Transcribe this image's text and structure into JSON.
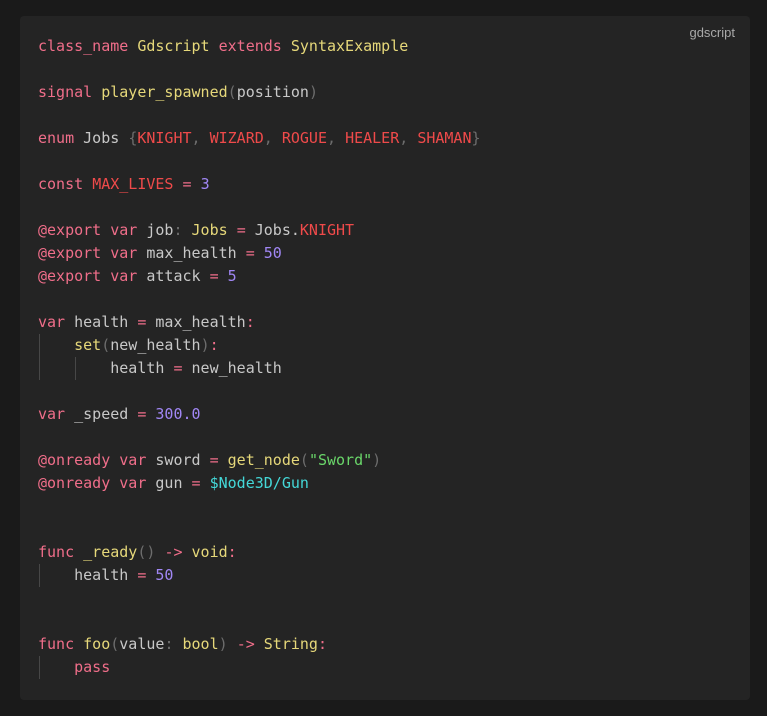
{
  "badge": "gdscript",
  "lines": [
    [
      {
        "t": "class_name",
        "c": "kw"
      },
      {
        "t": " ",
        "c": "tx"
      },
      {
        "t": "Gdscript",
        "c": "ty"
      },
      {
        "t": " ",
        "c": "tx"
      },
      {
        "t": "extends",
        "c": "kw"
      },
      {
        "t": " ",
        "c": "tx"
      },
      {
        "t": "SyntaxExample",
        "c": "ty"
      }
    ],
    [],
    [
      {
        "t": "signal",
        "c": "kw"
      },
      {
        "t": " ",
        "c": "tx"
      },
      {
        "t": "player_spawned",
        "c": "fn"
      },
      {
        "t": "(",
        "c": "pu"
      },
      {
        "t": "position",
        "c": "tx"
      },
      {
        "t": ")",
        "c": "pu"
      }
    ],
    [],
    [
      {
        "t": "enum",
        "c": "kw"
      },
      {
        "t": " Jobs ",
        "c": "tx"
      },
      {
        "t": "{",
        "c": "pu"
      },
      {
        "t": "KNIGHT",
        "c": "cn"
      },
      {
        "t": ", ",
        "c": "pu"
      },
      {
        "t": "WIZARD",
        "c": "cn"
      },
      {
        "t": ", ",
        "c": "pu"
      },
      {
        "t": "ROGUE",
        "c": "cn"
      },
      {
        "t": ", ",
        "c": "pu"
      },
      {
        "t": "HEALER",
        "c": "cn"
      },
      {
        "t": ", ",
        "c": "pu"
      },
      {
        "t": "SHAMAN",
        "c": "cn"
      },
      {
        "t": "}",
        "c": "pu"
      }
    ],
    [],
    [
      {
        "t": "const",
        "c": "kw"
      },
      {
        "t": " ",
        "c": "tx"
      },
      {
        "t": "MAX_LIVES",
        "c": "cn"
      },
      {
        "t": " ",
        "c": "tx"
      },
      {
        "t": "=",
        "c": "op"
      },
      {
        "t": " ",
        "c": "tx"
      },
      {
        "t": "3",
        "c": "num"
      }
    ],
    [],
    [
      {
        "t": "@export",
        "c": "kw"
      },
      {
        "t": " ",
        "c": "tx"
      },
      {
        "t": "var",
        "c": "kw"
      },
      {
        "t": " job",
        "c": "tx"
      },
      {
        "t": ":",
        "c": "pu"
      },
      {
        "t": " ",
        "c": "tx"
      },
      {
        "t": "Jobs",
        "c": "ty"
      },
      {
        "t": " ",
        "c": "tx"
      },
      {
        "t": "=",
        "c": "op"
      },
      {
        "t": " Jobs.",
        "c": "tx"
      },
      {
        "t": "KNIGHT",
        "c": "cn"
      }
    ],
    [
      {
        "t": "@export",
        "c": "kw"
      },
      {
        "t": " ",
        "c": "tx"
      },
      {
        "t": "var",
        "c": "kw"
      },
      {
        "t": " max_health ",
        "c": "tx"
      },
      {
        "t": "=",
        "c": "op"
      },
      {
        "t": " ",
        "c": "tx"
      },
      {
        "t": "50",
        "c": "num"
      }
    ],
    [
      {
        "t": "@export",
        "c": "kw"
      },
      {
        "t": " ",
        "c": "tx"
      },
      {
        "t": "var",
        "c": "kw"
      },
      {
        "t": " attack ",
        "c": "tx"
      },
      {
        "t": "=",
        "c": "op"
      },
      {
        "t": " ",
        "c": "tx"
      },
      {
        "t": "5",
        "c": "num"
      }
    ],
    [],
    [
      {
        "t": "var",
        "c": "kw"
      },
      {
        "t": " health ",
        "c": "tx"
      },
      {
        "t": "=",
        "c": "op"
      },
      {
        "t": " max_health",
        "c": "tx"
      },
      {
        "t": ":",
        "c": "op"
      }
    ],
    [
      {
        "t": "    ",
        "c": "tx"
      },
      {
        "t": "set",
        "c": "fn"
      },
      {
        "t": "(",
        "c": "pu"
      },
      {
        "t": "new_health",
        "c": "tx"
      },
      {
        "t": ")",
        "c": "pu"
      },
      {
        "t": ":",
        "c": "op"
      }
    ],
    [
      {
        "t": "        health ",
        "c": "tx"
      },
      {
        "t": "=",
        "c": "op"
      },
      {
        "t": " new_health",
        "c": "tx"
      }
    ],
    [],
    [
      {
        "t": "var",
        "c": "kw"
      },
      {
        "t": " _speed ",
        "c": "tx"
      },
      {
        "t": "=",
        "c": "op"
      },
      {
        "t": " ",
        "c": "tx"
      },
      {
        "t": "300.0",
        "c": "num"
      }
    ],
    [],
    [
      {
        "t": "@onready",
        "c": "kw"
      },
      {
        "t": " ",
        "c": "tx"
      },
      {
        "t": "var",
        "c": "kw"
      },
      {
        "t": " sword ",
        "c": "tx"
      },
      {
        "t": "=",
        "c": "op"
      },
      {
        "t": " ",
        "c": "tx"
      },
      {
        "t": "get_node",
        "c": "fn"
      },
      {
        "t": "(",
        "c": "pu"
      },
      {
        "t": "\"Sword\"",
        "c": "str"
      },
      {
        "t": ")",
        "c": "pu"
      }
    ],
    [
      {
        "t": "@onready",
        "c": "kw"
      },
      {
        "t": " ",
        "c": "tx"
      },
      {
        "t": "var",
        "c": "kw"
      },
      {
        "t": " gun ",
        "c": "tx"
      },
      {
        "t": "=",
        "c": "op"
      },
      {
        "t": " ",
        "c": "tx"
      },
      {
        "t": "$Node3D/Gun",
        "c": "np"
      }
    ],
    [],
    [],
    [
      {
        "t": "func",
        "c": "kw"
      },
      {
        "t": " ",
        "c": "tx"
      },
      {
        "t": "_ready",
        "c": "fn"
      },
      {
        "t": "()",
        "c": "pu"
      },
      {
        "t": " ",
        "c": "tx"
      },
      {
        "t": "->",
        "c": "op"
      },
      {
        "t": " ",
        "c": "tx"
      },
      {
        "t": "void",
        "c": "ty"
      },
      {
        "t": ":",
        "c": "op"
      }
    ],
    [
      {
        "t": "    health ",
        "c": "tx"
      },
      {
        "t": "=",
        "c": "op"
      },
      {
        "t": " ",
        "c": "tx"
      },
      {
        "t": "50",
        "c": "num"
      }
    ],
    [],
    [],
    [
      {
        "t": "func",
        "c": "kw"
      },
      {
        "t": " ",
        "c": "tx"
      },
      {
        "t": "foo",
        "c": "fn"
      },
      {
        "t": "(",
        "c": "pu"
      },
      {
        "t": "value",
        "c": "tx"
      },
      {
        "t": ":",
        "c": "pu"
      },
      {
        "t": " ",
        "c": "tx"
      },
      {
        "t": "bool",
        "c": "ty"
      },
      {
        "t": ")",
        "c": "pu"
      },
      {
        "t": " ",
        "c": "tx"
      },
      {
        "t": "->",
        "c": "op"
      },
      {
        "t": " ",
        "c": "tx"
      },
      {
        "t": "String",
        "c": "ty"
      },
      {
        "t": ":",
        "c": "op"
      }
    ],
    [
      {
        "t": "    ",
        "c": "tx"
      },
      {
        "t": "pass",
        "c": "kw"
      }
    ]
  ]
}
